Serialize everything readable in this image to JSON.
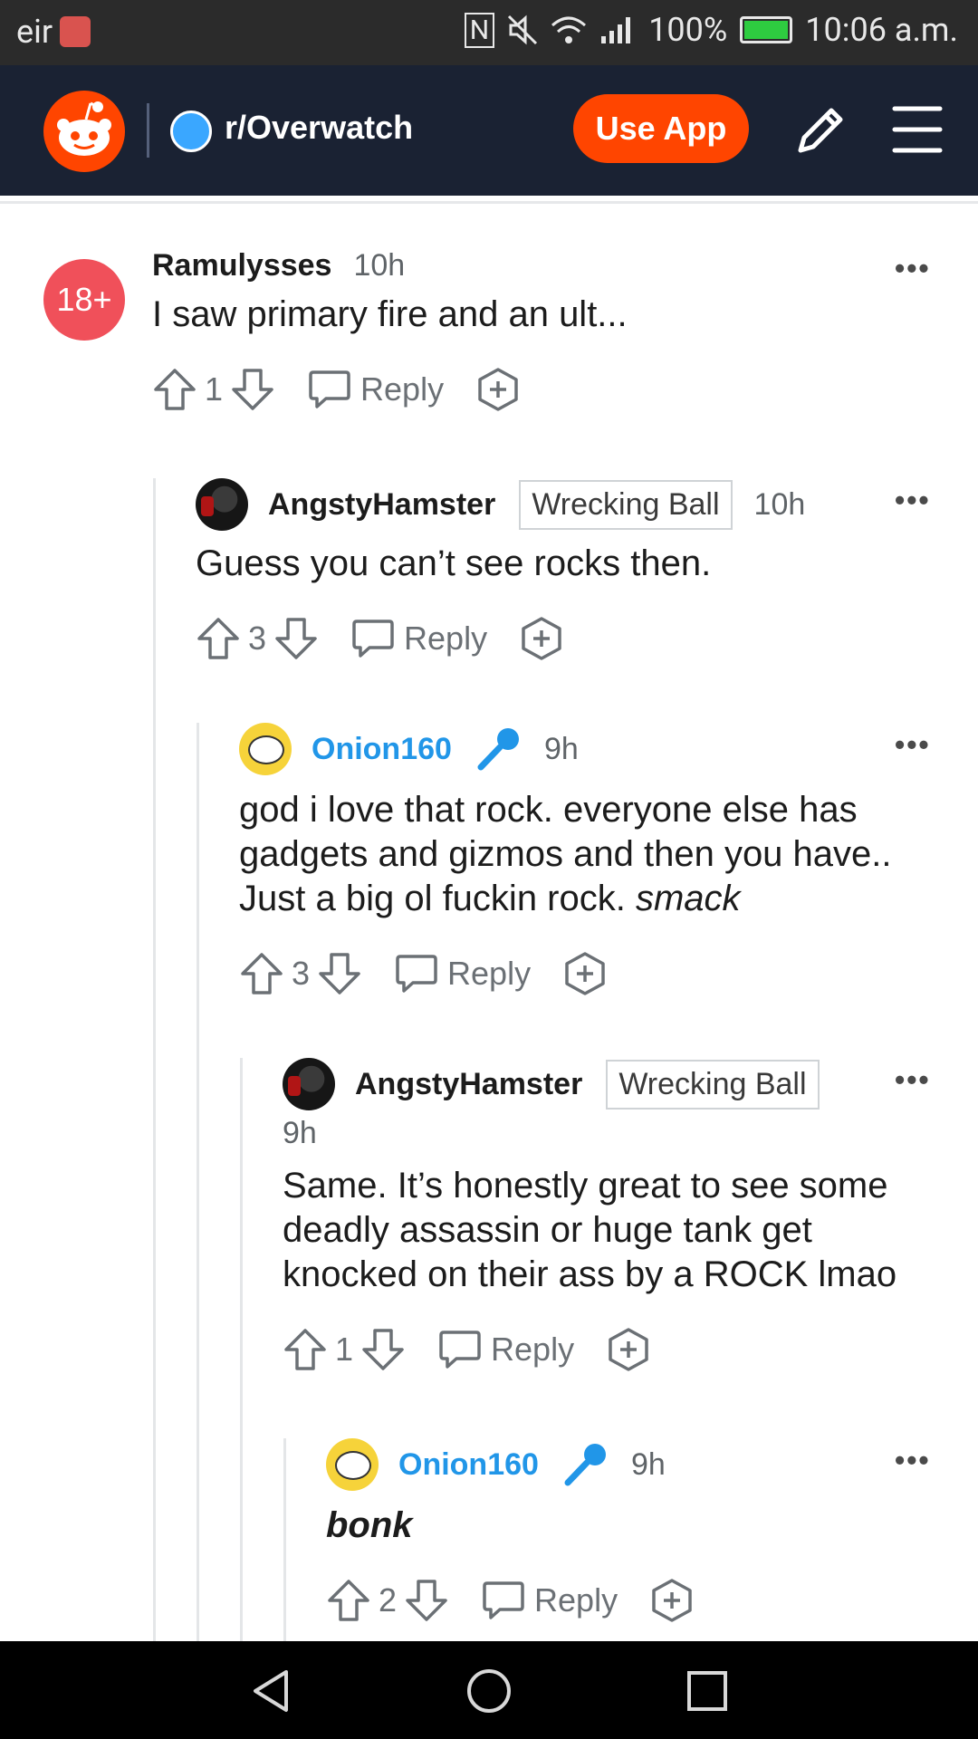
{
  "status_bar": {
    "carrier": "eir",
    "battery": "100%",
    "time": "10:06 a.m."
  },
  "header": {
    "subreddit": "r/Overwatch",
    "use_app_label": "Use App",
    "icons": [
      "reddit-logo-icon",
      "pencil-icon",
      "menu-icon"
    ]
  },
  "comments": [
    {
      "badge": "18+",
      "author": "Ramulysses",
      "time": "10h",
      "body": "I saw primary fire and an ult...",
      "score": "1",
      "reply_label": "Reply"
    },
    {
      "author": "AngstyHamster",
      "flair": "Wrecking Ball",
      "time": "10h",
      "body": "Guess you can’t see rocks then.",
      "score": "3",
      "reply_label": "Reply"
    },
    {
      "author": "Onion160",
      "time": "9h",
      "body": "god i love that rock. everyone else has gadgets and gizmos and then you have.. Just a big ol fuckin rock.",
      "body_italic": "smack",
      "score": "3",
      "reply_label": "Reply"
    },
    {
      "author": "AngstyHamster",
      "flair": "Wrecking Ball",
      "time": "9h",
      "body": "Same. It’s honestly great to see some deadly assassin or huge tank get knocked on their ass by a ROCK lmao",
      "score": "1",
      "reply_label": "Reply"
    },
    {
      "author": "Onion160",
      "time": "9h",
      "body": "bonk",
      "score": "2",
      "reply_label": "Reply"
    }
  ],
  "colors": {
    "brand": "#ff4500",
    "header_bg": "#1a2233",
    "link_blue": "#2196e8"
  }
}
